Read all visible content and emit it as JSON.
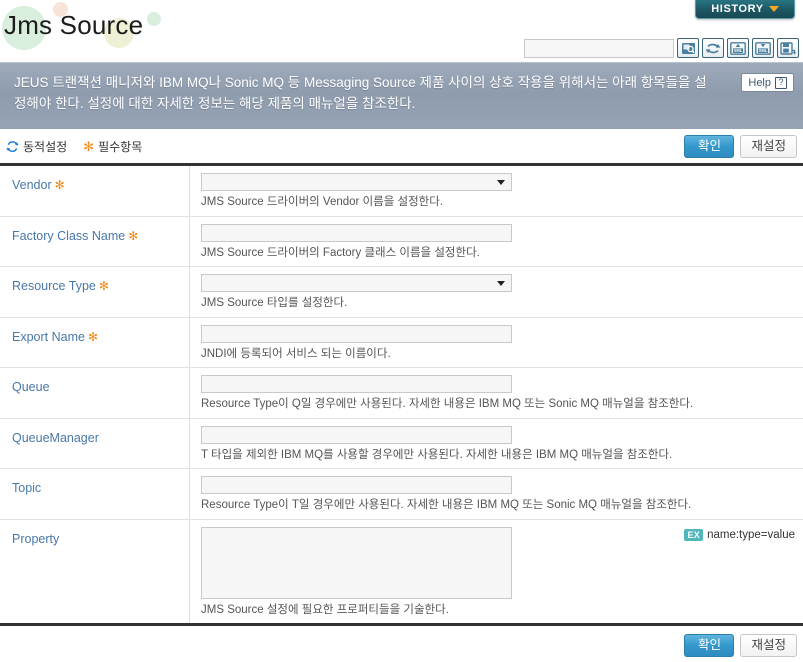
{
  "header": {
    "title": "Jms Source",
    "history_tab": {
      "label": "HISTORY",
      "chevron_icon": "chevron-down-icon"
    },
    "search": {
      "value": "",
      "placeholder": ""
    },
    "tools": [
      {
        "name": "search-icon",
        "title": "Search"
      },
      {
        "name": "refresh-icon",
        "title": "Refresh"
      },
      {
        "name": "xml-import-icon",
        "title": "Import XML"
      },
      {
        "name": "xml-export-icon",
        "title": "Export XML"
      },
      {
        "name": "save-as-icon",
        "title": "Save As"
      }
    ],
    "decorations": [
      {
        "name": "deco-circle-green-large",
        "color": "#d9eedd"
      },
      {
        "name": "deco-circle-peach",
        "color": "#f7e3d8"
      },
      {
        "name": "deco-circle-yellowgreen",
        "color": "#eff0d6"
      },
      {
        "name": "deco-circle-green-small",
        "color": "#d9eedd"
      }
    ]
  },
  "banner": {
    "text": "JEUS 트랜잭션 매니저와 IBM MQ나 Sonic MQ 등 Messaging Source 제품 사이의 상호 작용을 위해서는 아래 항목들을 설정해야 한다. 설정에 대한 자세한 정보는 해당 제품의 매뉴얼을 참조한다.",
    "help_label": "Help",
    "help_icon": "question-mark-icon",
    "bg_color": "#96a3b4"
  },
  "legend": {
    "dynamic_label": "동적설정",
    "dynamic_icon": "refresh-sync-icon",
    "required_label": "필수항목",
    "required_icon": "asterisk-icon",
    "confirm_label": "확인",
    "reset_label": "재설정",
    "accent_color": "#3498cd",
    "required_color": "#f08a1c"
  },
  "form": {
    "rows": [
      {
        "label": "Vendor",
        "required": true,
        "control": "select",
        "value": "",
        "desc": "JMS Source 드라이버의 Vendor 이름을 설정한다."
      },
      {
        "label": "Factory Class Name",
        "required": true,
        "control": "input",
        "value": "",
        "desc": "JMS Source 드라이버의 Factory 클래스 이름을 설정한다."
      },
      {
        "label": "Resource Type",
        "required": true,
        "control": "select",
        "value": "",
        "desc": "JMS Source 타입를 설정한다."
      },
      {
        "label": "Export Name",
        "required": true,
        "control": "input",
        "value": "",
        "desc": "JNDI에 등록되어 서비스 되는 이름이다."
      },
      {
        "label": "Queue",
        "required": false,
        "control": "input",
        "value": "",
        "desc": "Resource Type이 Q일 경우에만 사용된다. 자세한 내용은 IBM MQ 또는 Sonic MQ 매뉴얼을 참조한다."
      },
      {
        "label": "QueueManager",
        "required": false,
        "control": "input",
        "value": "",
        "desc": "T 타입을 제외한 IBM MQ를 사용할 경우에만 사용된다. 자세한 내용은 IBM MQ 매뉴얼을 참조한다."
      },
      {
        "label": "Topic",
        "required": false,
        "control": "input",
        "value": "",
        "desc": "Resource Type이 T일 경우에만 사용된다. 자세한 내용은 IBM MQ 또는 Sonic MQ 매뉴얼을 참조한다."
      },
      {
        "label": "Property",
        "required": false,
        "control": "textarea",
        "value": "",
        "desc": "JMS Source 설정에 필요한 프로퍼티들을 기술한다.",
        "example_badge": "EX",
        "example_text": "name:type=value"
      }
    ]
  },
  "footer": {
    "confirm_label": "확인",
    "reset_label": "재설정"
  }
}
